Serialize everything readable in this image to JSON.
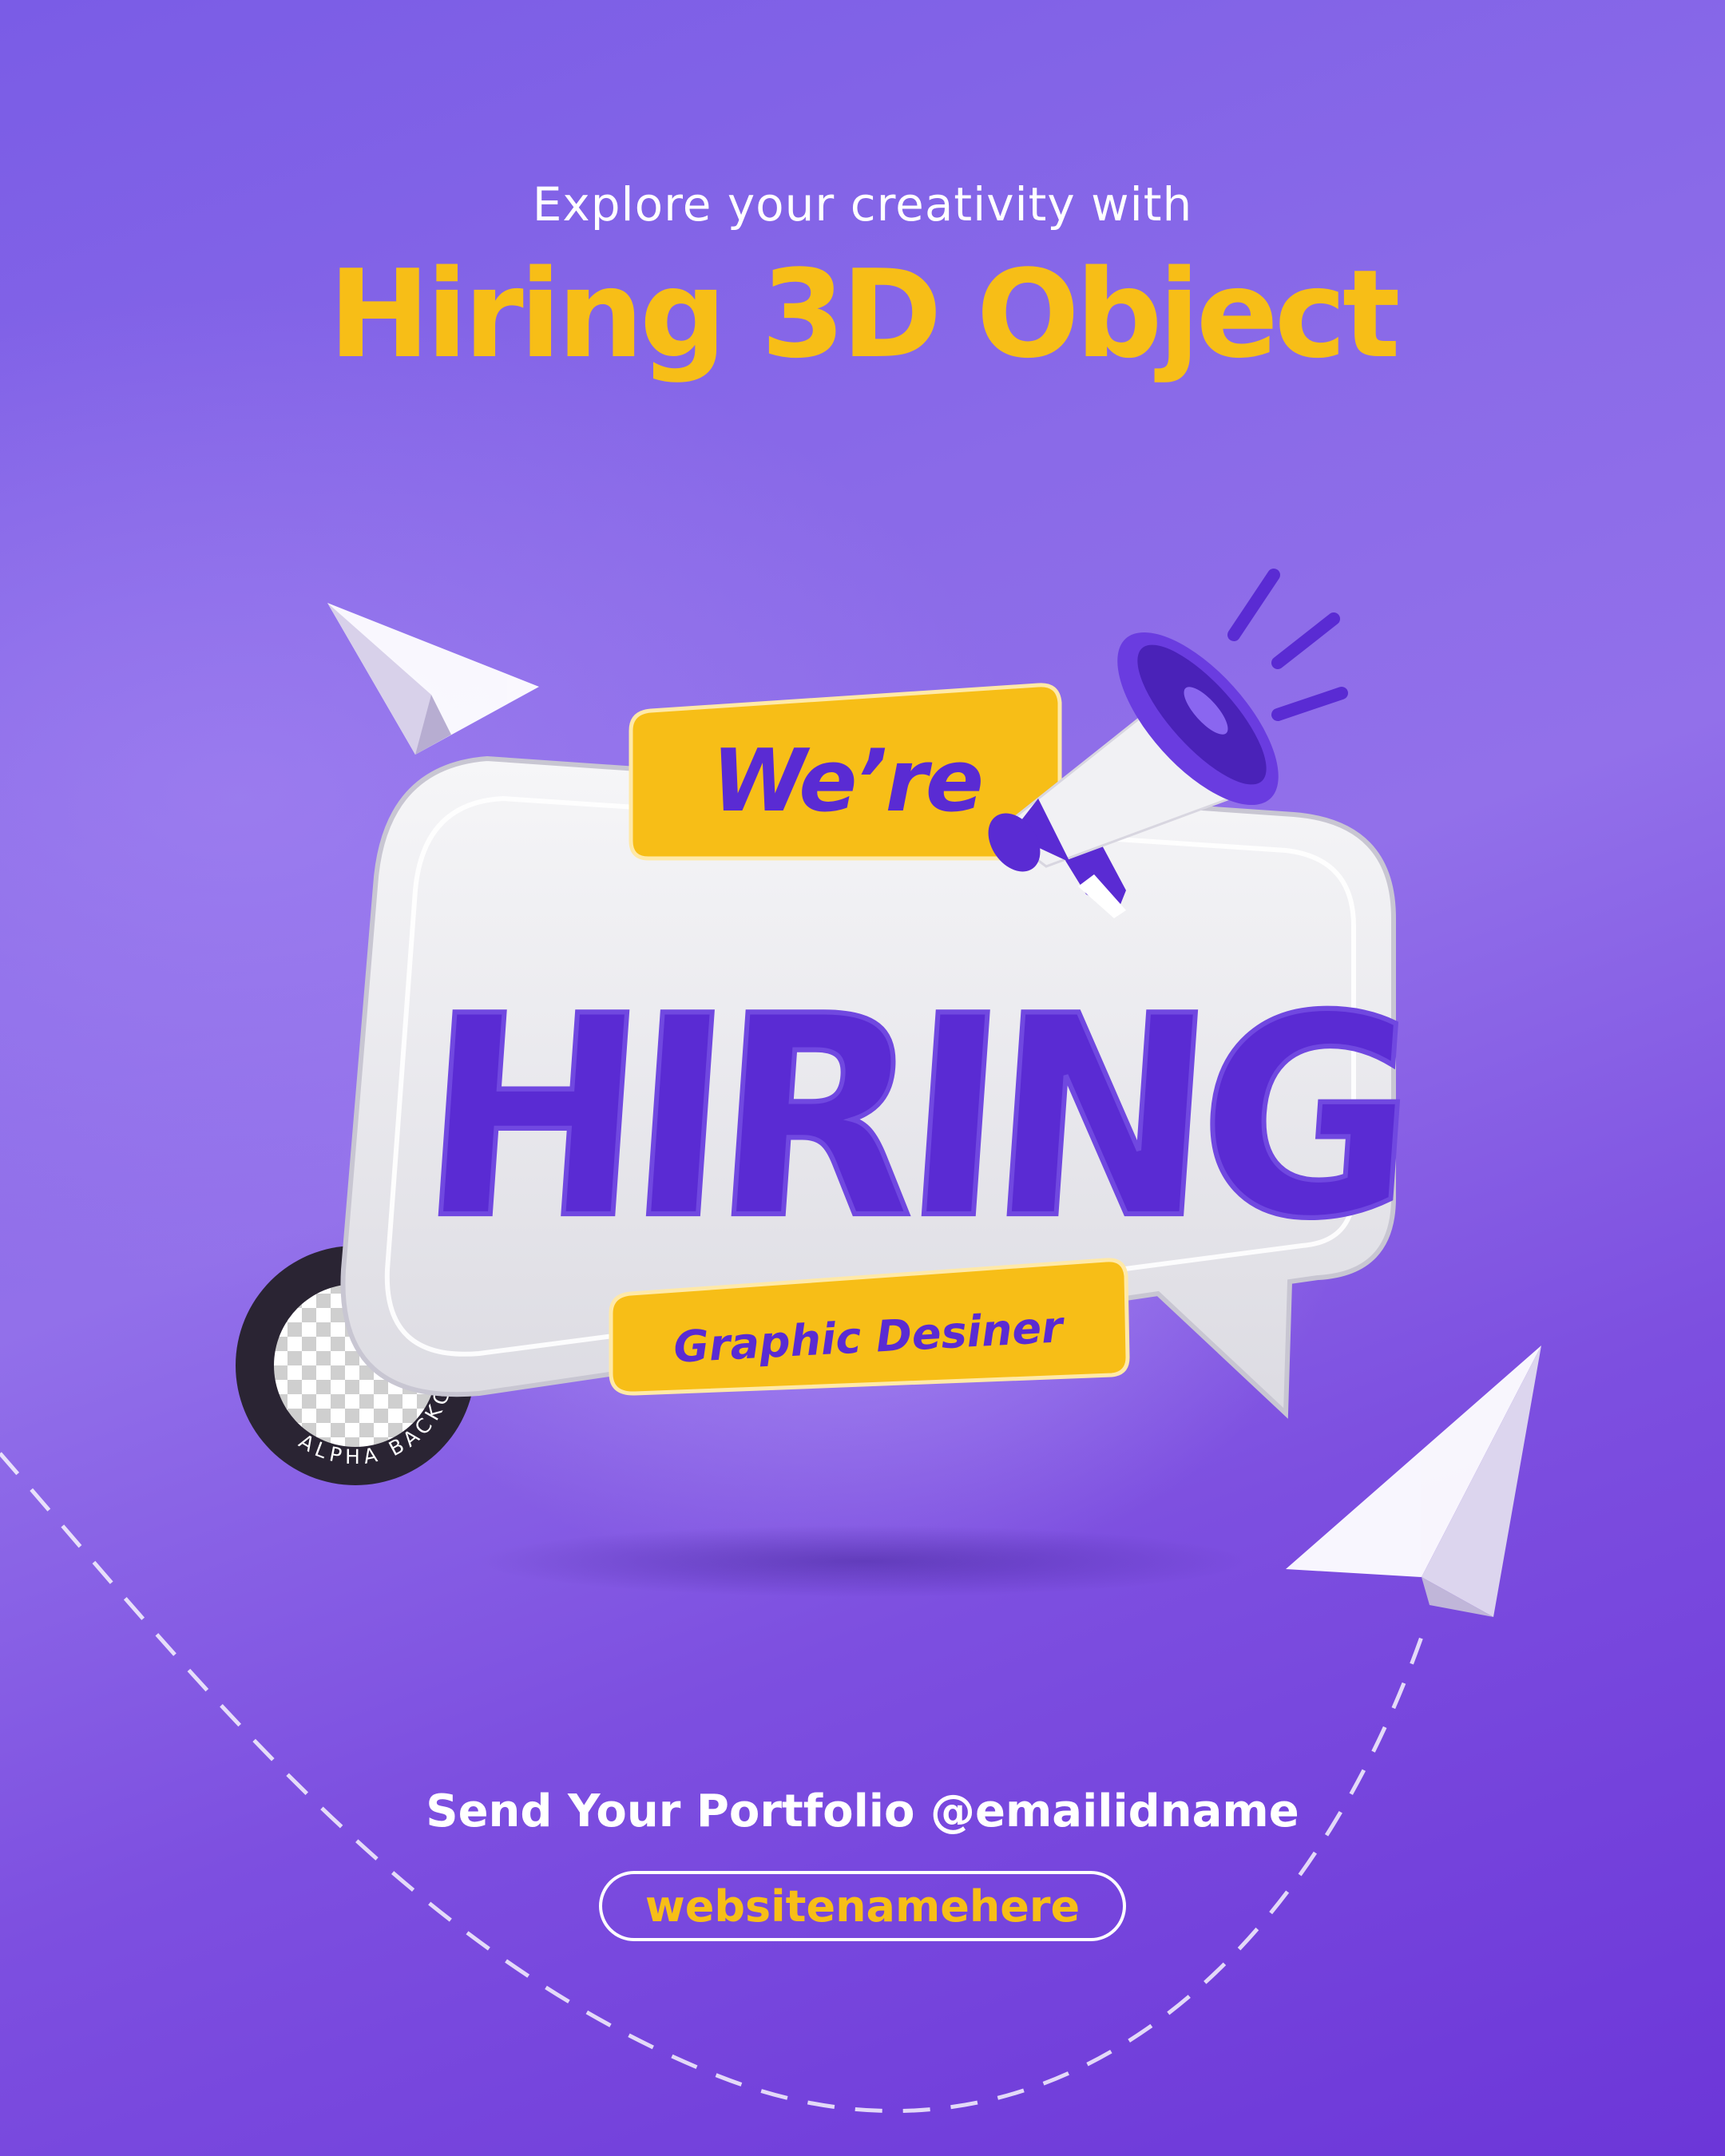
{
  "header": {
    "subtitle": "Explore your creativity with",
    "title": "Hiring 3D Object"
  },
  "bubble": {
    "top_tag": "We’re",
    "main_word": "HIRING",
    "bottom_tag": "Graphic Desiner"
  },
  "badge": {
    "text": "ALPHA BACKGROUND"
  },
  "footer": {
    "cta": "Send Your Portfolio @emailidname",
    "website": "websitenamehere"
  },
  "colors": {
    "accent_yellow": "#f7be17",
    "brand_purple": "#5a2bd3",
    "text_white": "#ffffff"
  },
  "icons": [
    "paper-plane-icon",
    "megaphone-icon",
    "transparency-badge-icon"
  ]
}
